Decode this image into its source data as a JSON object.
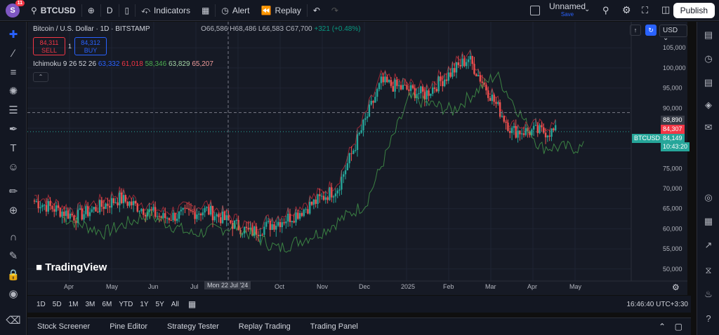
{
  "topbar": {
    "avatar_letter": "S",
    "notifications": "11",
    "symbol": "BTCUSD",
    "interval": "D",
    "indicators_label": "Indicators",
    "alert_label": "Alert",
    "replay_label": "Replay",
    "layout_name": "Unnamed",
    "layout_status": "Save",
    "publish_label": "Publish"
  },
  "legend": {
    "title": "Bitcoin / U.S. Dollar · 1D · BITSTAMP",
    "open": "O66,586",
    "high": "H68,486",
    "low": "L66,583",
    "close": "C67,700",
    "change": "+321 (+0.48%)"
  },
  "trade": {
    "sell_price": "84,311",
    "sell_label": "SELL",
    "spread": "1",
    "buy_price": "84,312",
    "buy_label": "BUY"
  },
  "ichimoku": {
    "label": "Ichimoku 9 26 52 26",
    "v1": "63,332",
    "v2": "61,018",
    "v3": "58,346",
    "v4": "63,829",
    "v5": "65,207"
  },
  "chart_data": {
    "type": "candlestick",
    "symbol": "BTCUSD",
    "currency": "USD",
    "y_ticks": [
      "105,000",
      "100,000",
      "95,000",
      "90,000",
      "85,000",
      "80,000",
      "75,000",
      "70,000",
      "65,000",
      "60,000",
      "55,000",
      "50,000"
    ],
    "ylim": [
      47000,
      108000
    ],
    "x_ticks": [
      "Apr",
      "May",
      "Jun",
      "Jul",
      "Sep",
      "Oct",
      "Nov",
      "Dec",
      "2025",
      "Feb",
      "Mar",
      "Apr",
      "May"
    ],
    "crosshair_date": "Mon 22 Jul '24",
    "crosshair_price": "88,890",
    "last_price_label": "BTCUSD",
    "last_price": "84,149",
    "countdown": "10:43:20",
    "red_line_price": "84,307",
    "monthly_closes": [
      {
        "month": "Apr 2024",
        "price": 63000
      },
      {
        "month": "May 2024",
        "price": 67500
      },
      {
        "month": "Jun 2024",
        "price": 62700
      },
      {
        "month": "Jul 2024",
        "price": 64600
      },
      {
        "month": "Aug 2024",
        "price": 59000
      },
      {
        "month": "Sep 2024",
        "price": 63300
      },
      {
        "month": "Oct 2024",
        "price": 70200
      },
      {
        "month": "Nov 2024",
        "price": 96400
      },
      {
        "month": "Dec 2024",
        "price": 93400
      },
      {
        "month": "Jan 2025",
        "price": 102400
      },
      {
        "month": "Feb 2025",
        "price": 84300
      },
      {
        "month": "Mar 2025",
        "price": 84149
      }
    ],
    "colors": {
      "up": "#26a69a",
      "down": "#ef5350",
      "background": "#161a25"
    }
  },
  "range_buttons": [
    "1D",
    "5D",
    "1M",
    "3M",
    "6M",
    "YTD",
    "1Y",
    "5Y",
    "All"
  ],
  "clock": "16:46:40 UTC+3:30",
  "panel_tabs": [
    "Stock Screener",
    "Pine Editor",
    "Strategy Tester",
    "Replay Trading",
    "Trading Panel"
  ],
  "brand": "TradingView",
  "usd_select": "USD"
}
